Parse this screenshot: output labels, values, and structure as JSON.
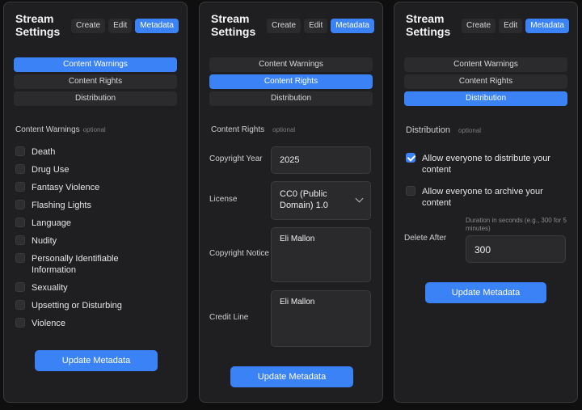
{
  "panels": [
    {
      "title": "Stream Settings",
      "tabs": [
        "Create",
        "Edit",
        "Metadata"
      ],
      "sections": [
        "Content Warnings",
        "Content Rights",
        "Distribution"
      ],
      "section_label": "Content Warnings",
      "optional": "optional",
      "warnings": [
        {
          "label": "Death",
          "checked": false
        },
        {
          "label": "Drug Use",
          "checked": false
        },
        {
          "label": "Fantasy Violence",
          "checked": false
        },
        {
          "label": "Flashing Lights",
          "checked": false
        },
        {
          "label": "Language",
          "checked": false
        },
        {
          "label": "Nudity",
          "checked": false
        },
        {
          "label": "Personally Identifiable Information",
          "checked": false
        },
        {
          "label": "Sexuality",
          "checked": false
        },
        {
          "label": "Upsetting or Disturbing",
          "checked": false
        },
        {
          "label": "Violence",
          "checked": false
        }
      ],
      "update_label": "Update Metadata"
    },
    {
      "title": "Stream Settings",
      "tabs": [
        "Create",
        "Edit",
        "Metadata"
      ],
      "sections": [
        "Content Warnings",
        "Content Rights",
        "Distribution"
      ],
      "section_label": "Content Rights",
      "optional": "optional",
      "copyright_year_label": "Copyright Year",
      "copyright_year_value": "2025",
      "license_label": "License",
      "license_value": "CC0 (Public Domain) 1.0",
      "copyright_notice_label": "Copyright Notice",
      "copyright_notice_value": "Eli Mallon",
      "credit_line_label": "Credit Line",
      "credit_line_value": "Eli Mallon",
      "update_label": "Update Metadata"
    },
    {
      "title": "Stream Settings",
      "tabs": [
        "Create",
        "Edit",
        "Metadata"
      ],
      "sections": [
        "Content Warnings",
        "Content Rights",
        "Distribution"
      ],
      "section_label": "Distribution",
      "optional": "optional",
      "allow_distribute_label": "Allow everyone to distribute your content",
      "allow_distribute_checked": true,
      "allow_archive_label": "Allow everyone to archive your content",
      "allow_archive_checked": false,
      "delete_after_label": "Delete After",
      "delete_after_hint": "Duration in seconds (e.g., 300 for 5 minutes)",
      "delete_after_value": "300",
      "update_label": "Update Metadata"
    }
  ],
  "colors": {
    "accent": "#3b82f6",
    "panel_bg": "#1f1f21",
    "control_bg": "#2b2b2e"
  }
}
